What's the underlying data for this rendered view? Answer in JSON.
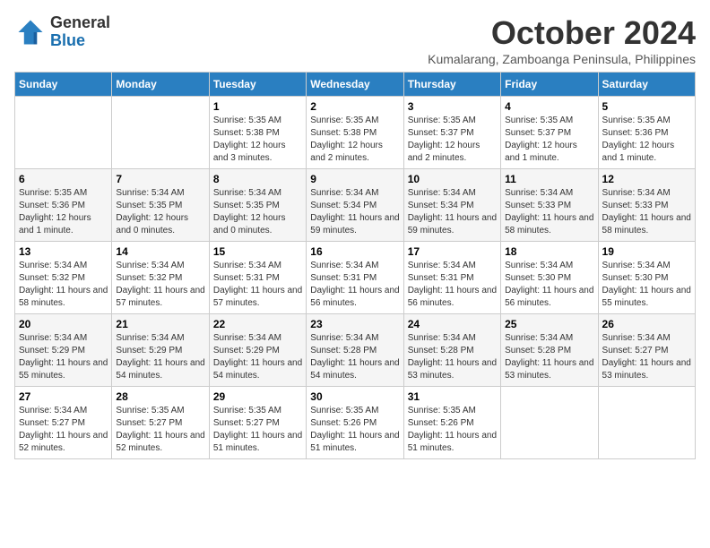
{
  "logo": {
    "text_general": "General",
    "text_blue": "Blue"
  },
  "header": {
    "month": "October 2024",
    "location": "Kumalarang, Zamboanga Peninsula, Philippines"
  },
  "weekdays": [
    "Sunday",
    "Monday",
    "Tuesday",
    "Wednesday",
    "Thursday",
    "Friday",
    "Saturday"
  ],
  "weeks": [
    [
      {
        "day": "",
        "sunrise": "",
        "sunset": "",
        "daylight": ""
      },
      {
        "day": "",
        "sunrise": "",
        "sunset": "",
        "daylight": ""
      },
      {
        "day": "1",
        "sunrise": "Sunrise: 5:35 AM",
        "sunset": "Sunset: 5:38 PM",
        "daylight": "Daylight: 12 hours and 3 minutes."
      },
      {
        "day": "2",
        "sunrise": "Sunrise: 5:35 AM",
        "sunset": "Sunset: 5:38 PM",
        "daylight": "Daylight: 12 hours and 2 minutes."
      },
      {
        "day": "3",
        "sunrise": "Sunrise: 5:35 AM",
        "sunset": "Sunset: 5:37 PM",
        "daylight": "Daylight: 12 hours and 2 minutes."
      },
      {
        "day": "4",
        "sunrise": "Sunrise: 5:35 AM",
        "sunset": "Sunset: 5:37 PM",
        "daylight": "Daylight: 12 hours and 1 minute."
      },
      {
        "day": "5",
        "sunrise": "Sunrise: 5:35 AM",
        "sunset": "Sunset: 5:36 PM",
        "daylight": "Daylight: 12 hours and 1 minute."
      }
    ],
    [
      {
        "day": "6",
        "sunrise": "Sunrise: 5:35 AM",
        "sunset": "Sunset: 5:36 PM",
        "daylight": "Daylight: 12 hours and 1 minute."
      },
      {
        "day": "7",
        "sunrise": "Sunrise: 5:34 AM",
        "sunset": "Sunset: 5:35 PM",
        "daylight": "Daylight: 12 hours and 0 minutes."
      },
      {
        "day": "8",
        "sunrise": "Sunrise: 5:34 AM",
        "sunset": "Sunset: 5:35 PM",
        "daylight": "Daylight: 12 hours and 0 minutes."
      },
      {
        "day": "9",
        "sunrise": "Sunrise: 5:34 AM",
        "sunset": "Sunset: 5:34 PM",
        "daylight": "Daylight: 11 hours and 59 minutes."
      },
      {
        "day": "10",
        "sunrise": "Sunrise: 5:34 AM",
        "sunset": "Sunset: 5:34 PM",
        "daylight": "Daylight: 11 hours and 59 minutes."
      },
      {
        "day": "11",
        "sunrise": "Sunrise: 5:34 AM",
        "sunset": "Sunset: 5:33 PM",
        "daylight": "Daylight: 11 hours and 58 minutes."
      },
      {
        "day": "12",
        "sunrise": "Sunrise: 5:34 AM",
        "sunset": "Sunset: 5:33 PM",
        "daylight": "Daylight: 11 hours and 58 minutes."
      }
    ],
    [
      {
        "day": "13",
        "sunrise": "Sunrise: 5:34 AM",
        "sunset": "Sunset: 5:32 PM",
        "daylight": "Daylight: 11 hours and 58 minutes."
      },
      {
        "day": "14",
        "sunrise": "Sunrise: 5:34 AM",
        "sunset": "Sunset: 5:32 PM",
        "daylight": "Daylight: 11 hours and 57 minutes."
      },
      {
        "day": "15",
        "sunrise": "Sunrise: 5:34 AM",
        "sunset": "Sunset: 5:31 PM",
        "daylight": "Daylight: 11 hours and 57 minutes."
      },
      {
        "day": "16",
        "sunrise": "Sunrise: 5:34 AM",
        "sunset": "Sunset: 5:31 PM",
        "daylight": "Daylight: 11 hours and 56 minutes."
      },
      {
        "day": "17",
        "sunrise": "Sunrise: 5:34 AM",
        "sunset": "Sunset: 5:31 PM",
        "daylight": "Daylight: 11 hours and 56 minutes."
      },
      {
        "day": "18",
        "sunrise": "Sunrise: 5:34 AM",
        "sunset": "Sunset: 5:30 PM",
        "daylight": "Daylight: 11 hours and 56 minutes."
      },
      {
        "day": "19",
        "sunrise": "Sunrise: 5:34 AM",
        "sunset": "Sunset: 5:30 PM",
        "daylight": "Daylight: 11 hours and 55 minutes."
      }
    ],
    [
      {
        "day": "20",
        "sunrise": "Sunrise: 5:34 AM",
        "sunset": "Sunset: 5:29 PM",
        "daylight": "Daylight: 11 hours and 55 minutes."
      },
      {
        "day": "21",
        "sunrise": "Sunrise: 5:34 AM",
        "sunset": "Sunset: 5:29 PM",
        "daylight": "Daylight: 11 hours and 54 minutes."
      },
      {
        "day": "22",
        "sunrise": "Sunrise: 5:34 AM",
        "sunset": "Sunset: 5:29 PM",
        "daylight": "Daylight: 11 hours and 54 minutes."
      },
      {
        "day": "23",
        "sunrise": "Sunrise: 5:34 AM",
        "sunset": "Sunset: 5:28 PM",
        "daylight": "Daylight: 11 hours and 54 minutes."
      },
      {
        "day": "24",
        "sunrise": "Sunrise: 5:34 AM",
        "sunset": "Sunset: 5:28 PM",
        "daylight": "Daylight: 11 hours and 53 minutes."
      },
      {
        "day": "25",
        "sunrise": "Sunrise: 5:34 AM",
        "sunset": "Sunset: 5:28 PM",
        "daylight": "Daylight: 11 hours and 53 minutes."
      },
      {
        "day": "26",
        "sunrise": "Sunrise: 5:34 AM",
        "sunset": "Sunset: 5:27 PM",
        "daylight": "Daylight: 11 hours and 53 minutes."
      }
    ],
    [
      {
        "day": "27",
        "sunrise": "Sunrise: 5:34 AM",
        "sunset": "Sunset: 5:27 PM",
        "daylight": "Daylight: 11 hours and 52 minutes."
      },
      {
        "day": "28",
        "sunrise": "Sunrise: 5:35 AM",
        "sunset": "Sunset: 5:27 PM",
        "daylight": "Daylight: 11 hours and 52 minutes."
      },
      {
        "day": "29",
        "sunrise": "Sunrise: 5:35 AM",
        "sunset": "Sunset: 5:27 PM",
        "daylight": "Daylight: 11 hours and 51 minutes."
      },
      {
        "day": "30",
        "sunrise": "Sunrise: 5:35 AM",
        "sunset": "Sunset: 5:26 PM",
        "daylight": "Daylight: 11 hours and 51 minutes."
      },
      {
        "day": "31",
        "sunrise": "Sunrise: 5:35 AM",
        "sunset": "Sunset: 5:26 PM",
        "daylight": "Daylight: 11 hours and 51 minutes."
      },
      {
        "day": "",
        "sunrise": "",
        "sunset": "",
        "daylight": ""
      },
      {
        "day": "",
        "sunrise": "",
        "sunset": "",
        "daylight": ""
      }
    ]
  ]
}
